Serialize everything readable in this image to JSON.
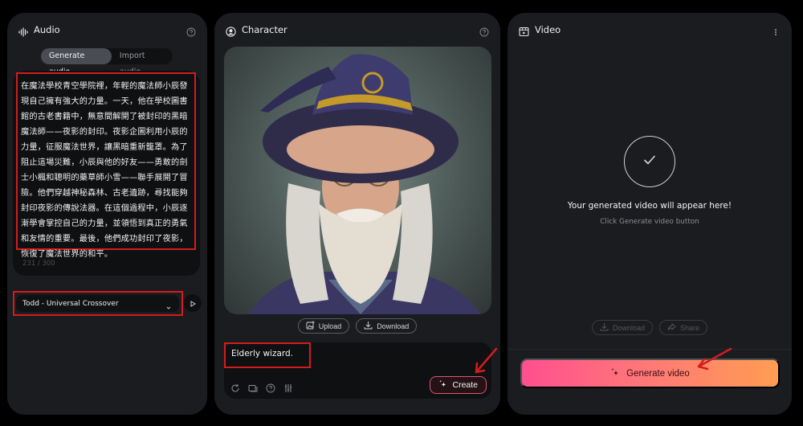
{
  "audio": {
    "title": "Audio",
    "icon": "audio-wave-icon",
    "tabs": [
      {
        "label": "Generate audio",
        "active": true
      },
      {
        "label": "Import audio",
        "active": false
      }
    ],
    "script_text": "在魔法學校青空學院裡，年輕的魔法師小辰發現自己擁有強大的力量。一天，他在學校圖書館的古老書籍中，無意間解開了被封印的黑暗魔法師——夜影的封印。夜影企圖利用小辰的力量，征服魔法世界，讓黑暗重新籠罩。為了阻止這場災難，小辰與他的好友——勇敢的劍士小楓和聰明的藥草師小雪——聯手展開了冒險。他們穿越神秘森林、古老遺跡，尋找能夠封印夜影的傳說法器。在這個過程中，小辰逐漸學會掌控自己的力量，並領悟到真正的勇氣和友情的重要。最後，他們成功封印了夜影，恢復了魔法世界的和平。",
    "char_count": "231 / 300",
    "voice": "Todd - Universal Crossover"
  },
  "character": {
    "title": "Character",
    "icon": "user-circle-icon",
    "image_alt": "Portrait of an elderly wizard with a purple hat, round glasses and long white beard",
    "upload_label": "Upload",
    "download_label": "Download",
    "prompt": "Elderly wizard.",
    "create_label": "Create"
  },
  "video": {
    "title": "Video",
    "icon": "video-icon",
    "placeholder_title": "Your generated video will appear here!",
    "placeholder_sub": "Click Generate video button",
    "download_label": "Download",
    "share_label": "Share",
    "generate_label": "Generate video"
  },
  "colors": {
    "panel_bg": "#1b1c1f",
    "highlight_red": "#d21d1d",
    "gradient_start": "#ff4f8f",
    "gradient_end": "#ff9d52"
  }
}
